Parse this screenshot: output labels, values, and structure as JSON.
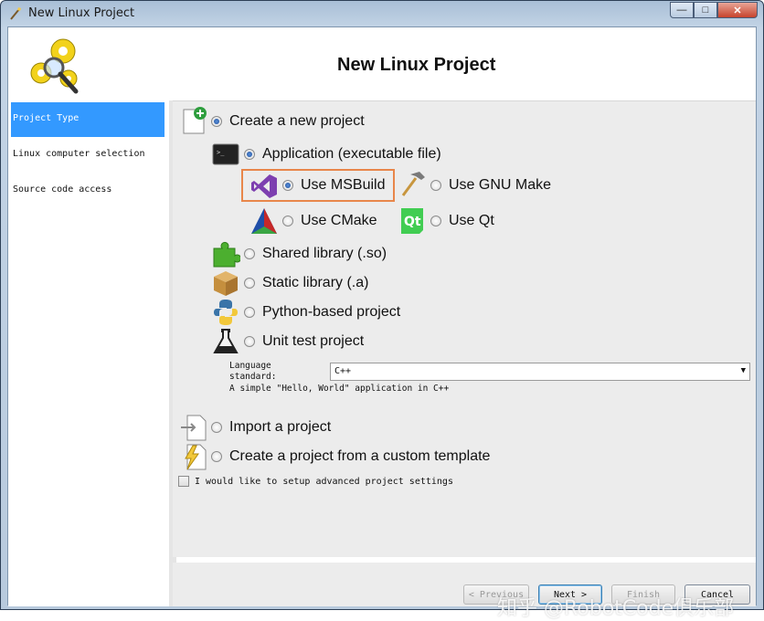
{
  "window": {
    "title": "New Linux Project",
    "controls": {
      "minimize": "—",
      "maximize": "□",
      "close": "✕"
    }
  },
  "header": {
    "title": "New Linux Project"
  },
  "sidebar": {
    "items": [
      {
        "label": "Project Type",
        "active": true
      },
      {
        "label": "Linux computer selection",
        "active": false
      },
      {
        "label": "Source code access",
        "active": false
      }
    ]
  },
  "options": {
    "create_new": {
      "label": "Create a new project",
      "selected": true
    },
    "application": {
      "label": "Application (executable file)",
      "selected": true
    },
    "msbuild": {
      "label": "Use MSBuild",
      "selected": true
    },
    "gnu_make": {
      "label": "Use GNU Make",
      "selected": false
    },
    "cmake": {
      "label": "Use CMake",
      "selected": false
    },
    "qt": {
      "label": "Use Qt",
      "selected": false
    },
    "shared_lib": {
      "label": "Shared library (.so)",
      "selected": false
    },
    "static_lib": {
      "label": "Static library (.a)",
      "selected": false
    },
    "python": {
      "label": "Python-based project",
      "selected": false
    },
    "unit_test": {
      "label": "Unit test project",
      "selected": false
    },
    "import": {
      "label": "Import a project",
      "selected": false
    },
    "custom_template": {
      "label": "Create a project from a custom template",
      "selected": false
    }
  },
  "language": {
    "label_line1": "Language",
    "label_line2": "standard:",
    "selected": "C++",
    "description": "A simple \"Hello, World\" application in C++"
  },
  "advanced": {
    "label": "I would like to setup advanced project settings",
    "checked": false
  },
  "buttons": {
    "previous": "< Previous",
    "next": "Next >",
    "finish": "Finish",
    "cancel": "Cancel"
  },
  "watermark": "知乎 @RobotCode俱乐部",
  "colors": {
    "sidebar_active": "#3399ff",
    "highlight": "#e8864a"
  }
}
